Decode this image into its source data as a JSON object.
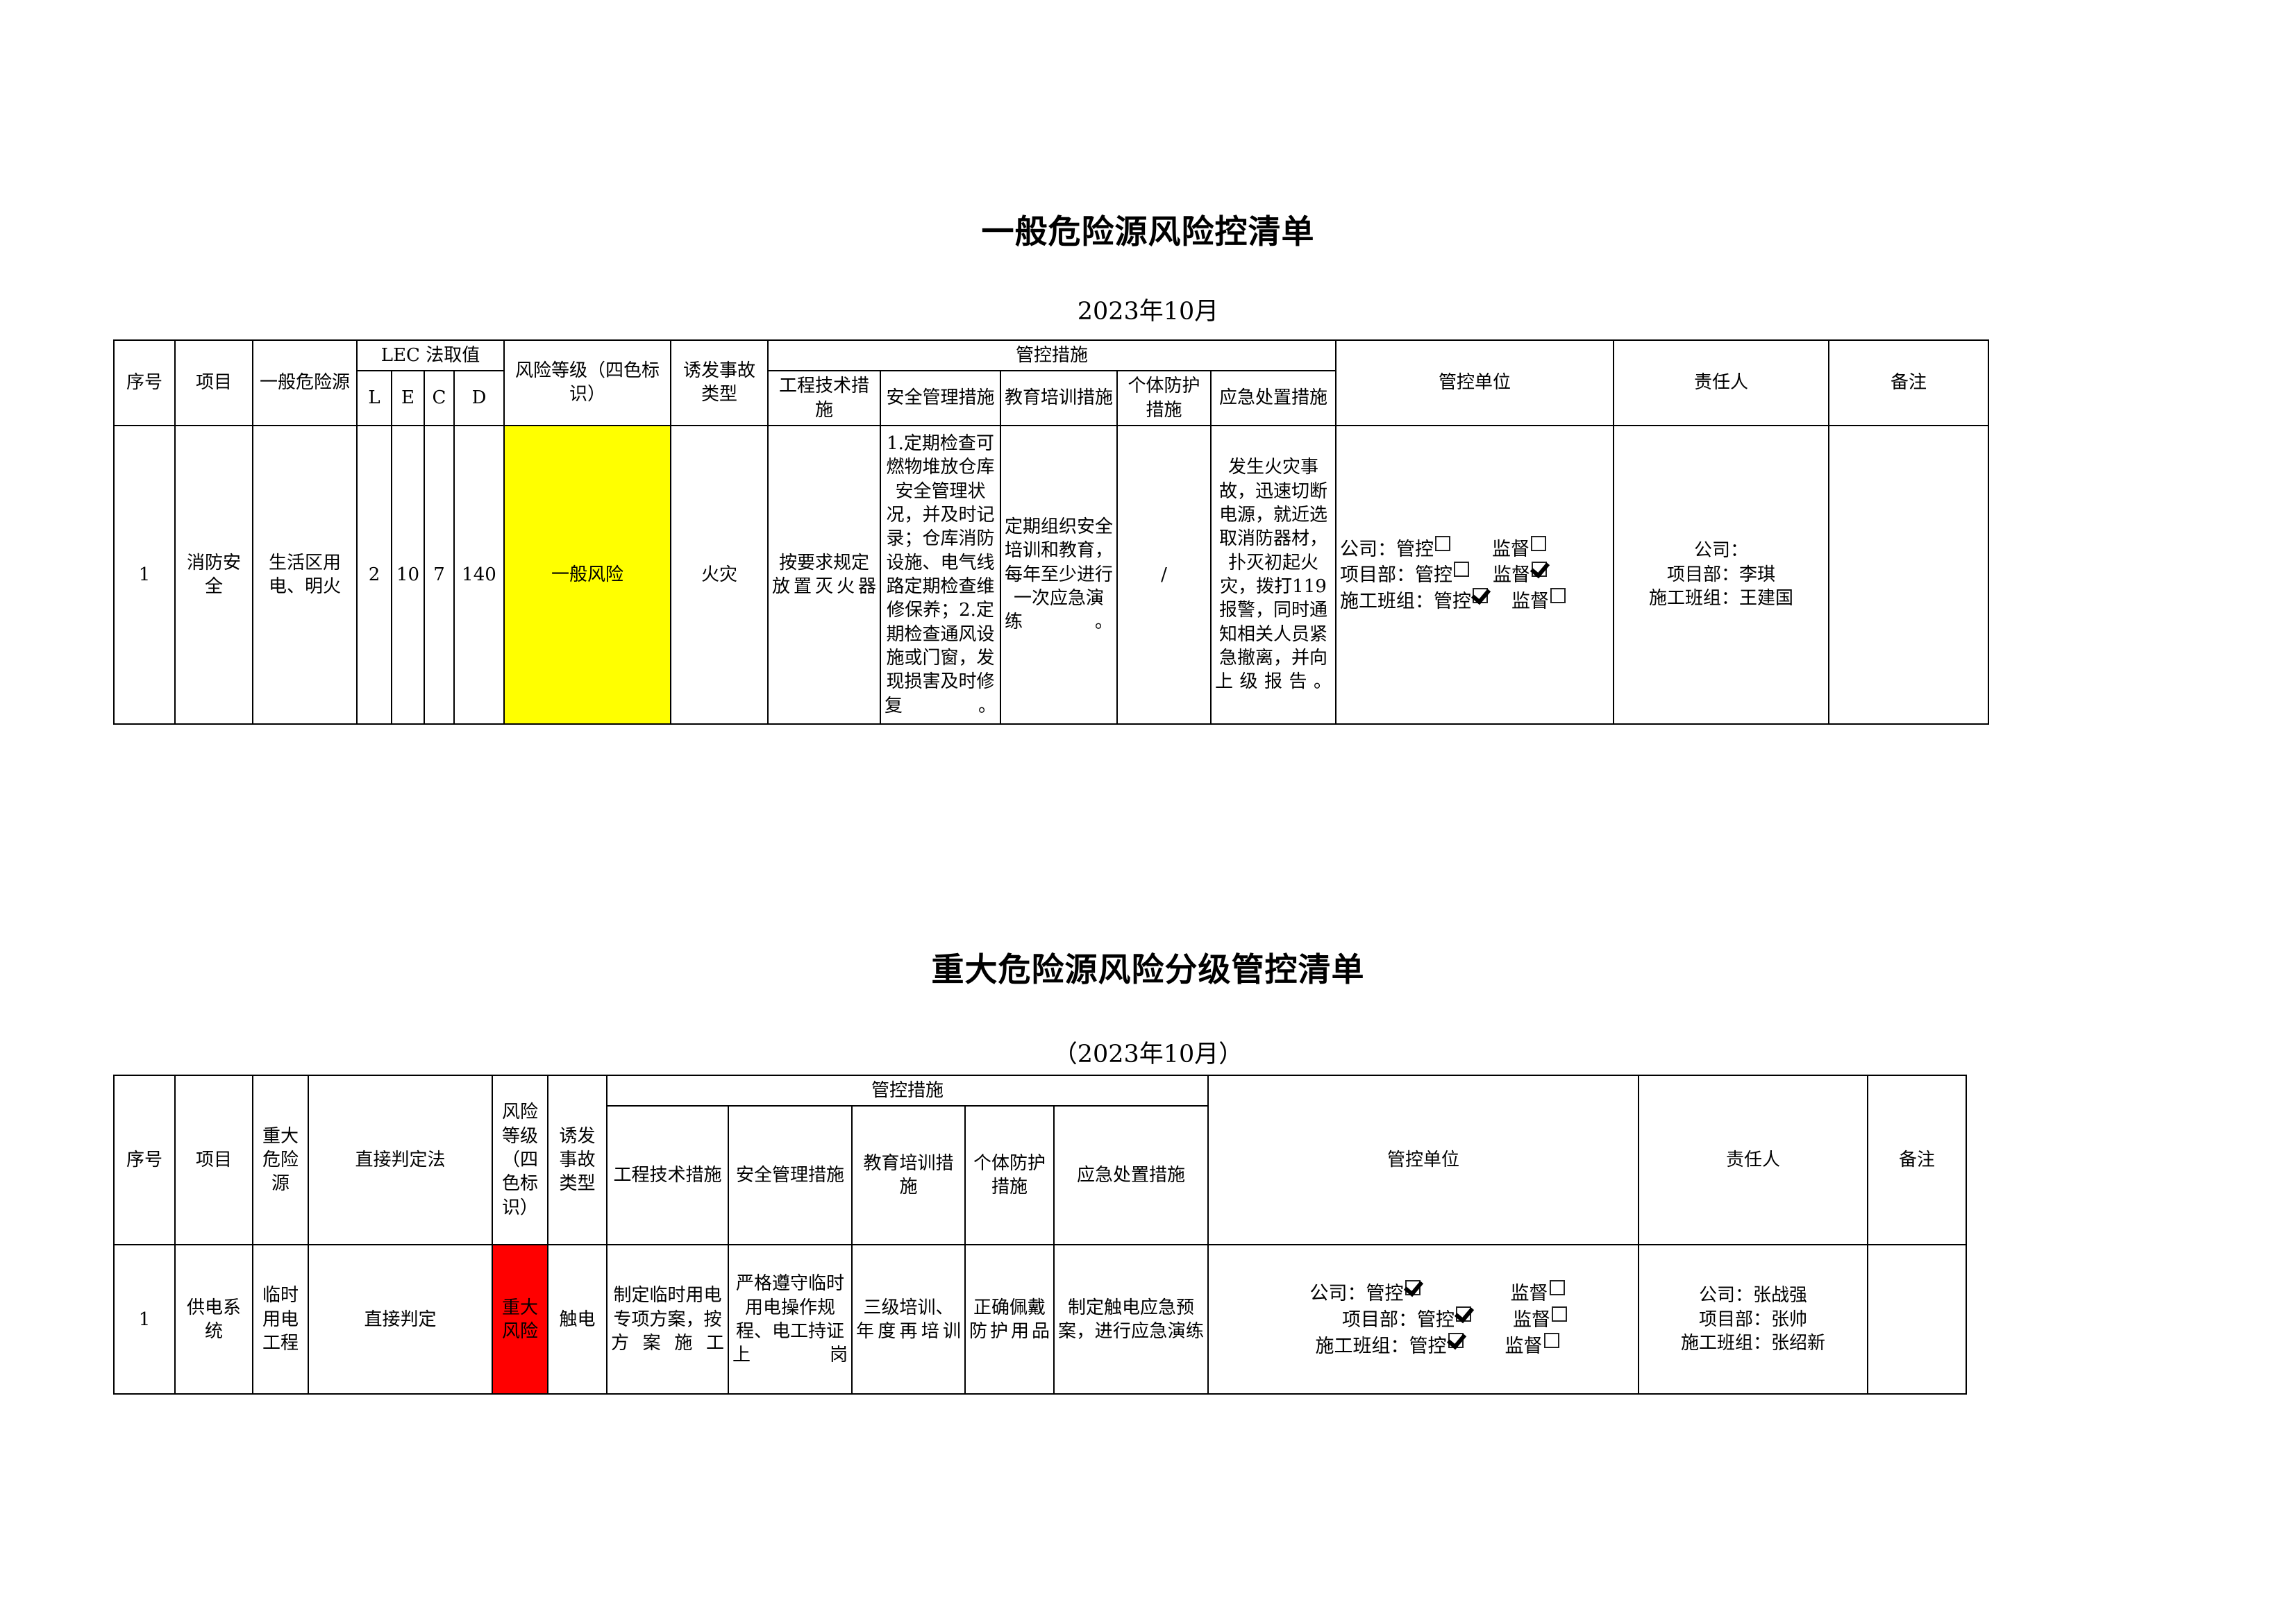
{
  "table1": {
    "title": "一般危险源风险控清单",
    "subtitle": "2023年10月",
    "headers": {
      "seq": "序号",
      "project": "项目",
      "hazard": "一般危险源",
      "lec": "LEC 法取值",
      "l": "L",
      "e": "E",
      "c": "C",
      "d": "D",
      "level": "风险等级（四色标识）",
      "accident": "诱发事故类型",
      "measures": "管控措施",
      "m_eng": "工程技术措施",
      "m_safety": "安全管理措施",
      "m_edu": "教育培训措施",
      "m_ppe": "个体防护措施",
      "m_emerg": "应急处置措施",
      "unit": "管控单位",
      "person": "责任人",
      "remark": "备注"
    },
    "rows": [
      {
        "seq": "1",
        "project": "消防安全",
        "hazard": "生活区用电、明火",
        "l": "2",
        "e": "10",
        "c": "7",
        "d": "140",
        "level": "一般风险",
        "level_color": "#FFFF00",
        "accident": "火灾",
        "m_eng": "按要求规定放置灭火器",
        "m_safety": "1.定期检查可燃物堆放仓库安全管理状况，并及时记录；仓库消防设施、电气线路定期检查维修保养；2.定期检查通风设施或门窗，发现损害及时修复。",
        "m_edu": "定期组织安全培训和教育，每年至少进行一次应急演练。",
        "m_ppe": "/",
        "m_emerg": "发生火灾事故，迅速切断电源，就近选取消防器材，扑灭初起火灾，拨打119报警，同时通知相关人员紧急撤离，并向上级报告。",
        "unit": {
          "company_label": "公司：",
          "project_label": "项目部：",
          "team_label": "施工班组：",
          "control_label": "管控",
          "supervise_label": "监督",
          "company_control": false,
          "company_supervise": false,
          "project_control": false,
          "project_supervise": true,
          "team_control": true,
          "team_supervise": false
        },
        "person": {
          "company": "公司：",
          "project": "项目部：李琪",
          "team": "施工班组：王建国"
        },
        "remark": ""
      }
    ]
  },
  "table2": {
    "title": "重大危险源风险分级管控清单",
    "subtitle": "（2023年10月）",
    "headers": {
      "seq": "序号",
      "project": "项目",
      "hazard": "重大危险源",
      "method": "直接判定法",
      "level": "风险等级（四色标识）",
      "accident": "诱发事故类型",
      "measures": "管控措施",
      "m_eng": "工程技术措施",
      "m_safety": "安全管理措施",
      "m_edu": "教育培训措施",
      "m_ppe": "个体防护措施",
      "m_emerg": "应急处置措施",
      "unit": "管控单位",
      "person": "责任人",
      "remark": "备注"
    },
    "rows": [
      {
        "seq": "1",
        "project": "供电系统",
        "hazard": "临时用电工程",
        "method": "直接判定",
        "level": "重大风险",
        "level_color": "#FF0000",
        "accident": "触电",
        "m_eng": "制定临时用电专项方案，按方案施工",
        "m_safety": "严格遵守临时用电操作规程、电工持证上岗",
        "m_edu": "三级培训、年度再培训",
        "m_ppe": "正确佩戴防护用品",
        "m_emerg": "制定触电应急预案，进行应急演练",
        "unit": {
          "company_label": "公司：",
          "project_label": "项目部：",
          "team_label": "施工班组：",
          "control_label": "管控",
          "supervise_label": "监督",
          "company_control": true,
          "company_supervise": false,
          "project_control": true,
          "project_supervise": false,
          "team_control": true,
          "team_supervise": false
        },
        "person": {
          "company": "公司：张战强",
          "project": "项目部：张帅",
          "team": "施工班组：张绍新"
        },
        "remark": ""
      }
    ]
  }
}
